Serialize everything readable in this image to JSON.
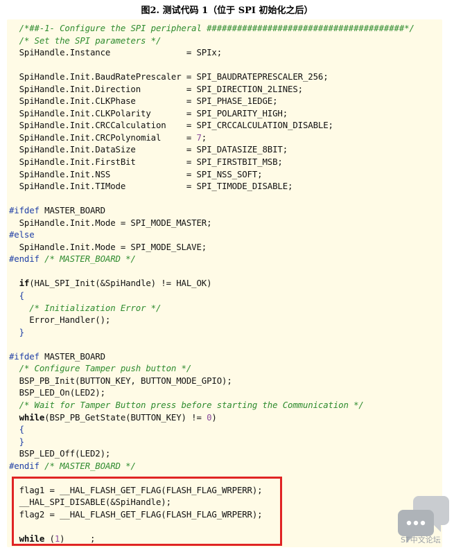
{
  "caption": "图2. 测试代码 1（位于 SPI 初始化之后）",
  "watermark": "ST中文论坛",
  "code_lines": [
    [
      {
        "t": "  ",
        "s": ""
      },
      {
        "t": "/*##-1- Configure the SPI peripheral #######################################*/",
        "s": "c"
      }
    ],
    [
      {
        "t": "  ",
        "s": ""
      },
      {
        "t": "/* Set the SPI parameters */",
        "s": "c"
      }
    ],
    [
      {
        "t": "  SpiHandle.Instance               = SPIx;",
        "s": ""
      }
    ],
    [
      {
        "t": "",
        "s": ""
      }
    ],
    [
      {
        "t": "  SpiHandle.Init.BaudRatePrescaler = SPI_BAUDRATEPRESCALER_256;",
        "s": ""
      }
    ],
    [
      {
        "t": "  SpiHandle.Init.Direction         = SPI_DIRECTION_2LINES;",
        "s": ""
      }
    ],
    [
      {
        "t": "  SpiHandle.Init.CLKPhase          = SPI_PHASE_1EDGE;",
        "s": ""
      }
    ],
    [
      {
        "t": "  SpiHandle.Init.CLKPolarity       = SPI_POLARITY_HIGH;",
        "s": ""
      }
    ],
    [
      {
        "t": "  SpiHandle.Init.CRCCalculation    = SPI_CRCCALCULATION_DISABLE;",
        "s": ""
      }
    ],
    [
      {
        "t": "  SpiHandle.Init.CRCPolynomial     = ",
        "s": ""
      },
      {
        "t": "7",
        "s": "n"
      },
      {
        "t": ";",
        "s": ""
      }
    ],
    [
      {
        "t": "  SpiHandle.Init.DataSize          = SPI_DATASIZE_8BIT;",
        "s": ""
      }
    ],
    [
      {
        "t": "  SpiHandle.Init.FirstBit          = SPI_FIRSTBIT_MSB;",
        "s": ""
      }
    ],
    [
      {
        "t": "  SpiHandle.Init.NSS               = SPI_NSS_SOFT;",
        "s": ""
      }
    ],
    [
      {
        "t": "  SpiHandle.Init.TIMode            = SPI_TIMODE_DISABLE;",
        "s": ""
      }
    ],
    [
      {
        "t": "",
        "s": ""
      }
    ],
    [
      {
        "t": "#ifdef",
        "s": "p"
      },
      {
        "t": " MASTER_BOARD",
        "s": ""
      }
    ],
    [
      {
        "t": "  SpiHandle.Init.Mode = SPI_MODE_MASTER;",
        "s": ""
      }
    ],
    [
      {
        "t": "#else",
        "s": "p"
      }
    ],
    [
      {
        "t": "  SpiHandle.Init.Mode = SPI_MODE_SLAVE;",
        "s": ""
      }
    ],
    [
      {
        "t": "#endif",
        "s": "p"
      },
      {
        "t": " ",
        "s": ""
      },
      {
        "t": "/* MASTER_BOARD */",
        "s": "c"
      }
    ],
    [
      {
        "t": "",
        "s": ""
      }
    ],
    [
      {
        "t": "  ",
        "s": ""
      },
      {
        "t": "if",
        "s": "k"
      },
      {
        "t": "(HAL_SPI_Init(&SpiHandle) != HAL_OK)",
        "s": ""
      }
    ],
    [
      {
        "t": "  ",
        "s": ""
      },
      {
        "t": "{",
        "s": "b"
      }
    ],
    [
      {
        "t": "    ",
        "s": ""
      },
      {
        "t": "/* Initialization Error */",
        "s": "c"
      }
    ],
    [
      {
        "t": "    Error_Handler();",
        "s": ""
      }
    ],
    [
      {
        "t": "  ",
        "s": ""
      },
      {
        "t": "}",
        "s": "b"
      }
    ],
    [
      {
        "t": "",
        "s": ""
      }
    ],
    [
      {
        "t": "#ifdef",
        "s": "p"
      },
      {
        "t": " MASTER_BOARD",
        "s": ""
      }
    ],
    [
      {
        "t": "  ",
        "s": ""
      },
      {
        "t": "/* Configure Tamper push button */",
        "s": "c"
      }
    ],
    [
      {
        "t": "  BSP_PB_Init(BUTTON_KEY, BUTTON_MODE_GPIO);",
        "s": ""
      }
    ],
    [
      {
        "t": "  BSP_LED_On(LED2);",
        "s": ""
      }
    ],
    [
      {
        "t": "  ",
        "s": ""
      },
      {
        "t": "/* Wait for Tamper Button press before starting the Communication */",
        "s": "c"
      }
    ],
    [
      {
        "t": "  ",
        "s": ""
      },
      {
        "t": "while",
        "s": "k"
      },
      {
        "t": "(BSP_PB_GetState(BUTTON_KEY) != ",
        "s": ""
      },
      {
        "t": "0",
        "s": "n"
      },
      {
        "t": ")",
        "s": ""
      }
    ],
    [
      {
        "t": "  ",
        "s": ""
      },
      {
        "t": "{",
        "s": "b"
      }
    ],
    [
      {
        "t": "  ",
        "s": ""
      },
      {
        "t": "}",
        "s": "b"
      }
    ],
    [
      {
        "t": "  BSP_LED_Off(LED2);",
        "s": ""
      }
    ],
    [
      {
        "t": "#endif",
        "s": "p"
      },
      {
        "t": " ",
        "s": ""
      },
      {
        "t": "/* MASTER_BOARD */",
        "s": "c"
      }
    ],
    [
      {
        "t": "",
        "s": ""
      }
    ],
    [
      {
        "t": "  flag1 = __HAL_FLASH_GET_FLAG(FLASH_FLAG_WRPERR);",
        "s": ""
      }
    ],
    [
      {
        "t": "  __HAL_SPI_DISABLE(&SpiHandle);",
        "s": ""
      }
    ],
    [
      {
        "t": "  flag2 = __HAL_FLASH_GET_FLAG(FLASH_FLAG_WRPERR);",
        "s": ""
      }
    ],
    [
      {
        "t": "",
        "s": ""
      }
    ],
    [
      {
        "t": "  ",
        "s": ""
      },
      {
        "t": "while",
        "s": "k"
      },
      {
        "t": " (",
        "s": ""
      },
      {
        "t": "1",
        "s": "n"
      },
      {
        "t": ")     ;",
        "s": ""
      }
    ]
  ],
  "highlight_color": "#e02424"
}
